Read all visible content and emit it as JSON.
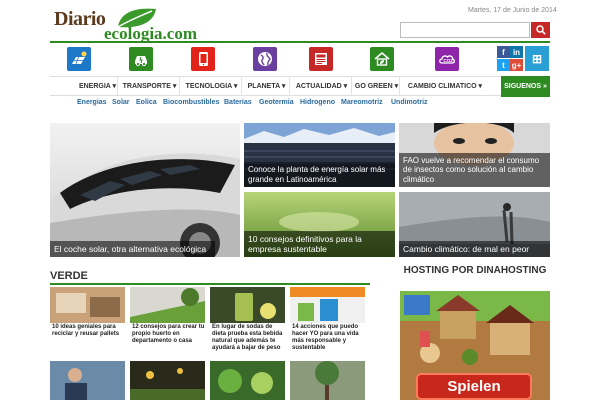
{
  "header": {
    "logo_line1": "Diario",
    "logo_line2": "ecologia.com",
    "date": "Martes, 17 de Junio de 2014",
    "search_placeholder": ""
  },
  "icons": [
    {
      "name": "solar-panel-icon",
      "color": "#1e78c8"
    },
    {
      "name": "electric-car-icon",
      "color": "#2e8b22"
    },
    {
      "name": "tablet-icon",
      "color": "#e2231a"
    },
    {
      "name": "globe-icon",
      "color": "#6a3fa0"
    },
    {
      "name": "newspaper-icon",
      "color": "#c62828"
    },
    {
      "name": "eco-house-icon",
      "color": "#2e8b22"
    },
    {
      "name": "co2-cloud-icon",
      "color": "#8e24aa"
    }
  ],
  "social": [
    {
      "label": "f",
      "color": "#3b5998"
    },
    {
      "label": "in",
      "color": "#0e76a8"
    },
    {
      "label": "t",
      "color": "#1da1f2"
    },
    {
      "label": "g+",
      "color": "#dd4b39"
    },
    {
      "label": "rss",
      "color": "#f26522"
    },
    {
      "label": "⊞",
      "color": "#2a9fd6"
    }
  ],
  "nav": {
    "items": [
      "ENERGIA ▾",
      "TRANSPORTE ▾",
      "TECNOLOGIA ▾",
      "PLANETA ▾",
      "ACTUALIDAD ▾",
      "GO GREEN ▾",
      "CAMBIO CLIMATICO ▾"
    ],
    "follow": "SIGUENOS »"
  },
  "subnav": [
    "Energias",
    "Solar",
    "Eolica",
    "Biocombustibles",
    "Baterias",
    "Geotermia",
    "Hidrogeno",
    "Mareomotriz",
    "Undimotriz"
  ],
  "featured": {
    "main": "El coche solar, otra alternativa ecológica",
    "a": "Conoce la planta de energía solar más grande en Latinoamérica",
    "b": "FAO vuelve a recomendar el consumo de insectos como solución al cambio climático",
    "c": "10 consejos definitivos para la empresa sustentable",
    "d": "Cambio climático: de mal en peor"
  },
  "section": {
    "verde": "VERDE",
    "hosting": "HOSTING POR DINAHOSTING"
  },
  "thumbs": [
    {
      "title": "10 ideas geniales para reciclar y reusar pallets"
    },
    {
      "title": "12 consejos para crear tu propio huerto en departamento o casa"
    },
    {
      "title": "En lugar de sodas de dieta prueba esta bebida natural que además te ayudará a bajar de peso"
    },
    {
      "title": "14 acciones que puedo hacer YO para una vida más responsable y sustentable"
    }
  ],
  "ad": {
    "button": "Spielen"
  }
}
